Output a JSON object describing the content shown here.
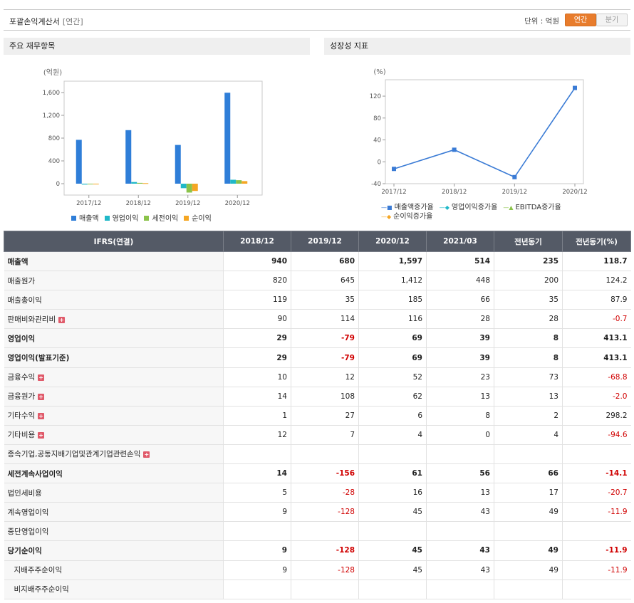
{
  "header": {
    "title": "포괄손익계산서",
    "subtitle": "[연간]",
    "unit_label": "단위 : 억원",
    "tab_annual": "연간",
    "tab_quarter": "분기"
  },
  "panels": {
    "left_title": "주요 재무항목",
    "right_title": "성장성 지표"
  },
  "colors": {
    "sales": "#2f7ed8",
    "op_income": "#20b8c8",
    "pretax": "#8bc34a",
    "net": "#f5a623",
    "line": "#3a7bd5",
    "neg_text": "#d00000",
    "header_bg": "#545a66",
    "active_tab": "#e87c2c"
  },
  "chart_data": [
    {
      "type": "bar",
      "title": "",
      "ylabel": "(억원)",
      "categories": [
        "2017/12",
        "2018/12",
        "2019/12",
        "2020/12"
      ],
      "ylim": [
        -200,
        1800
      ],
      "yticks": [
        0,
        400,
        800,
        1200,
        1600
      ],
      "ytick_labels": [
        "0",
        "400",
        "800",
        "1,200",
        "1,600"
      ],
      "series": [
        {
          "name": "매출액",
          "values": [
            770,
            940,
            680,
            1597
          ]
        },
        {
          "name": "영업이익",
          "values": [
            -15,
            29,
            -79,
            69
          ]
        },
        {
          "name": "세전이익",
          "values": [
            -12,
            14,
            -156,
            61
          ]
        },
        {
          "name": "순이익",
          "values": [
            -10,
            9,
            -128,
            45
          ]
        }
      ],
      "legend_position": "bottom",
      "grid": false
    },
    {
      "type": "line",
      "title": "",
      "ylabel": "(%)",
      "categories": [
        "2017/12",
        "2018/12",
        "2019/12",
        "2020/12"
      ],
      "ylim": [
        -40,
        150
      ],
      "yticks": [
        -40,
        0,
        40,
        80,
        120
      ],
      "series": [
        {
          "name": "매출액증가율",
          "values": [
            -13,
            22,
            -28,
            135
          ]
        },
        {
          "name": "영업이익증가율",
          "values": [
            null,
            null,
            null,
            null
          ]
        },
        {
          "name": "EBITDA증가율",
          "values": [
            null,
            null,
            null,
            null
          ]
        },
        {
          "name": "순이익증가율",
          "values": [
            null,
            null,
            null,
            null
          ]
        }
      ],
      "legend_position": "bottom",
      "grid": false
    }
  ],
  "table": {
    "columns": [
      "IFRS(연결)",
      "2018/12",
      "2019/12",
      "2020/12",
      "2021/03",
      "전년동기",
      "전년동기(%)"
    ],
    "rows": [
      {
        "label": "매출액",
        "values": [
          "940",
          "680",
          "1,597",
          "514",
          "235",
          "118.7"
        ],
        "bold": true,
        "expand": false,
        "indent": false
      },
      {
        "label": "매출원가",
        "values": [
          "820",
          "645",
          "1,412",
          "448",
          "200",
          "124.2"
        ],
        "bold": false,
        "expand": false,
        "indent": false
      },
      {
        "label": "매출총이익",
        "values": [
          "119",
          "35",
          "185",
          "66",
          "35",
          "87.9"
        ],
        "bold": false,
        "expand": false,
        "indent": false
      },
      {
        "label": "판매비와관리비",
        "values": [
          "90",
          "114",
          "116",
          "28",
          "28",
          "-0.7"
        ],
        "bold": false,
        "expand": true,
        "indent": false
      },
      {
        "label": "영업이익",
        "values": [
          "29",
          "-79",
          "69",
          "39",
          "8",
          "413.1"
        ],
        "bold": true,
        "expand": false,
        "indent": false
      },
      {
        "label": "영업이익(발표기준)",
        "values": [
          "29",
          "-79",
          "69",
          "39",
          "8",
          "413.1"
        ],
        "bold": true,
        "expand": false,
        "indent": false
      },
      {
        "label": "금융수익",
        "values": [
          "10",
          "12",
          "52",
          "23",
          "73",
          "-68.8"
        ],
        "bold": false,
        "expand": true,
        "indent": false
      },
      {
        "label": "금융원가",
        "values": [
          "14",
          "108",
          "62",
          "13",
          "13",
          "-2.0"
        ],
        "bold": false,
        "expand": true,
        "indent": false
      },
      {
        "label": "기타수익",
        "values": [
          "1",
          "27",
          "6",
          "8",
          "2",
          "298.2"
        ],
        "bold": false,
        "expand": true,
        "indent": false
      },
      {
        "label": "기타비용",
        "values": [
          "12",
          "7",
          "4",
          "0",
          "4",
          "-94.6"
        ],
        "bold": false,
        "expand": true,
        "indent": false
      },
      {
        "label": "종속기업,공동지배기업및관계기업관련손익",
        "values": [
          "",
          "",
          "",
          "",
          "",
          ""
        ],
        "bold": false,
        "expand": true,
        "indent": false
      },
      {
        "label": "세전계속사업이익",
        "values": [
          "14",
          "-156",
          "61",
          "56",
          "66",
          "-14.1"
        ],
        "bold": true,
        "expand": false,
        "indent": false
      },
      {
        "label": "법인세비용",
        "values": [
          "5",
          "-28",
          "16",
          "13",
          "17",
          "-20.7"
        ],
        "bold": false,
        "expand": false,
        "indent": false
      },
      {
        "label": "계속영업이익",
        "values": [
          "9",
          "-128",
          "45",
          "43",
          "49",
          "-11.9"
        ],
        "bold": false,
        "expand": false,
        "indent": false
      },
      {
        "label": "중단영업이익",
        "values": [
          "",
          "",
          "",
          "",
          "",
          ""
        ],
        "bold": false,
        "expand": false,
        "indent": false
      },
      {
        "label": "당기순이익",
        "values": [
          "9",
          "-128",
          "45",
          "43",
          "49",
          "-11.9"
        ],
        "bold": true,
        "expand": false,
        "indent": false
      },
      {
        "label": "지배주주순이익",
        "values": [
          "9",
          "-128",
          "45",
          "43",
          "49",
          "-11.9"
        ],
        "bold": false,
        "expand": false,
        "indent": true
      },
      {
        "label": "비지배주주순이익",
        "values": [
          "",
          "",
          "",
          "",
          "",
          ""
        ],
        "bold": false,
        "expand": false,
        "indent": true
      }
    ]
  }
}
